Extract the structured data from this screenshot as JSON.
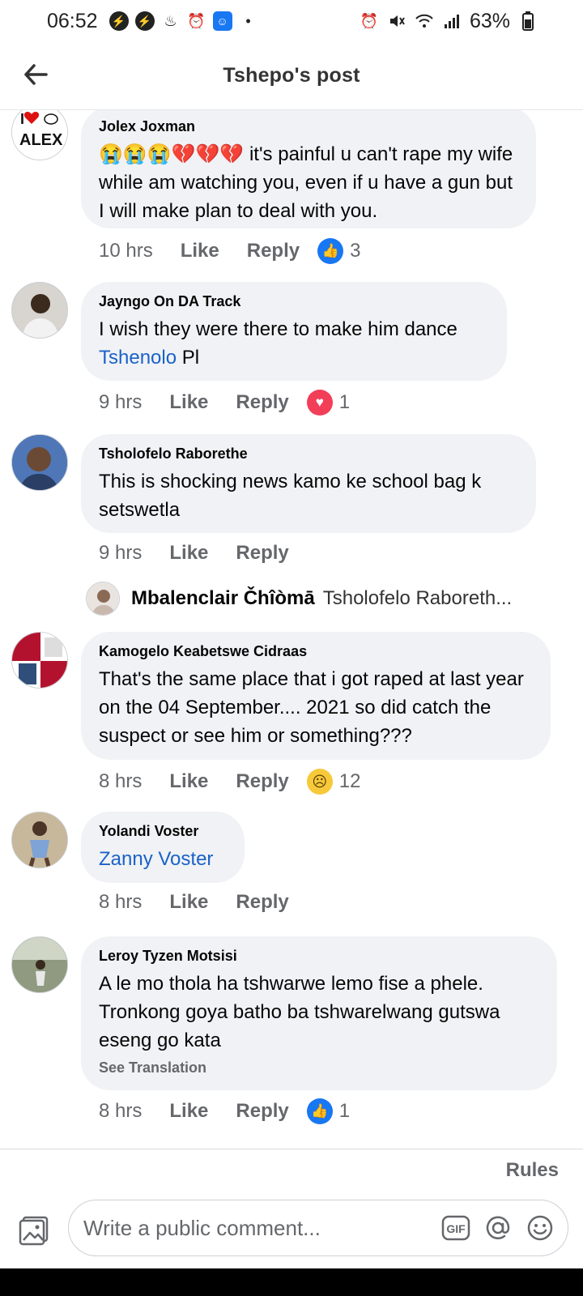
{
  "status_bar": {
    "time": "06:52",
    "battery": "63%",
    "left_icons": [
      "messenger-icon",
      "messenger-icon",
      "notification-icon",
      "alarm-icon",
      "facebook-app-icon",
      "dot-icon"
    ],
    "right_icons": [
      "alarm-icon",
      "mute-icon",
      "wifi-icon",
      "signal-icon",
      "battery-icon"
    ]
  },
  "header": {
    "title": "Tshepo's post",
    "back_icon": "arrow-left-icon"
  },
  "comments": [
    {
      "author": "Jolex Joxman",
      "text_emoji": "😭😭😭💔💔💔",
      "text": " it's painful u can't rape my wife while am watching you, even if u have a gun but I will make plan to deal with you.",
      "time": "10 hrs",
      "like": "Like",
      "reply": "Reply",
      "reaction": "like",
      "reaction_count": "3"
    },
    {
      "author": "Jayngo On DA Track",
      "text": "I wish they were there to make him dance ",
      "mention": "Tshenolo",
      "text_after": " Pl",
      "time": "9 hrs",
      "like": "Like",
      "reply": "Reply",
      "reaction": "love",
      "reaction_count": "1"
    },
    {
      "author": "Tsholofelo Raborethe",
      "text": "This is shocking news kamo ke school bag k setswetla",
      "time": "9 hrs",
      "like": "Like",
      "reply": "Reply"
    },
    {
      "author": "Kamogelo Keabetswe Cidraas",
      "text": "That's the same place that i got raped at last year on the 04  September....  2021 so did catch the suspect or see him or something???",
      "time": "8 hrs",
      "like": "Like",
      "reply": "Reply",
      "reaction": "sad",
      "reaction_count": "12"
    },
    {
      "author": "Yolandi Voster",
      "mention": "Zanny Voster",
      "time": "8 hrs",
      "like": "Like",
      "reply": "Reply"
    },
    {
      "author": "Leroy Tyzen Motsisi",
      "text": "A le mo thola ha tshwarwe lemo fise a phele. Tronkong goya batho ba tshwarelwang gutswa eseng go kata",
      "see_translation": "See Translation",
      "time": "8 hrs",
      "like": "Like",
      "reply": "Reply",
      "reaction": "like",
      "reaction_count": "1"
    }
  ],
  "reply_preview": {
    "name": "Mbalenclair Čhîòmā",
    "snippet": "Tsholofelo Raboreth..."
  },
  "avatar_alex_text": "ALEX",
  "footer": {
    "rules": "Rules",
    "input_placeholder": "Write a public comment...",
    "gif_label": "GIF",
    "icons": [
      "photo-icon",
      "gif-icon",
      "mention-icon",
      "emoji-icon"
    ]
  },
  "colors": {
    "accent": "#1877f2",
    "mention": "#1a62c8",
    "bubble": "#f0f2f5",
    "secondary_text": "#65676b",
    "love": "#f33e58"
  }
}
